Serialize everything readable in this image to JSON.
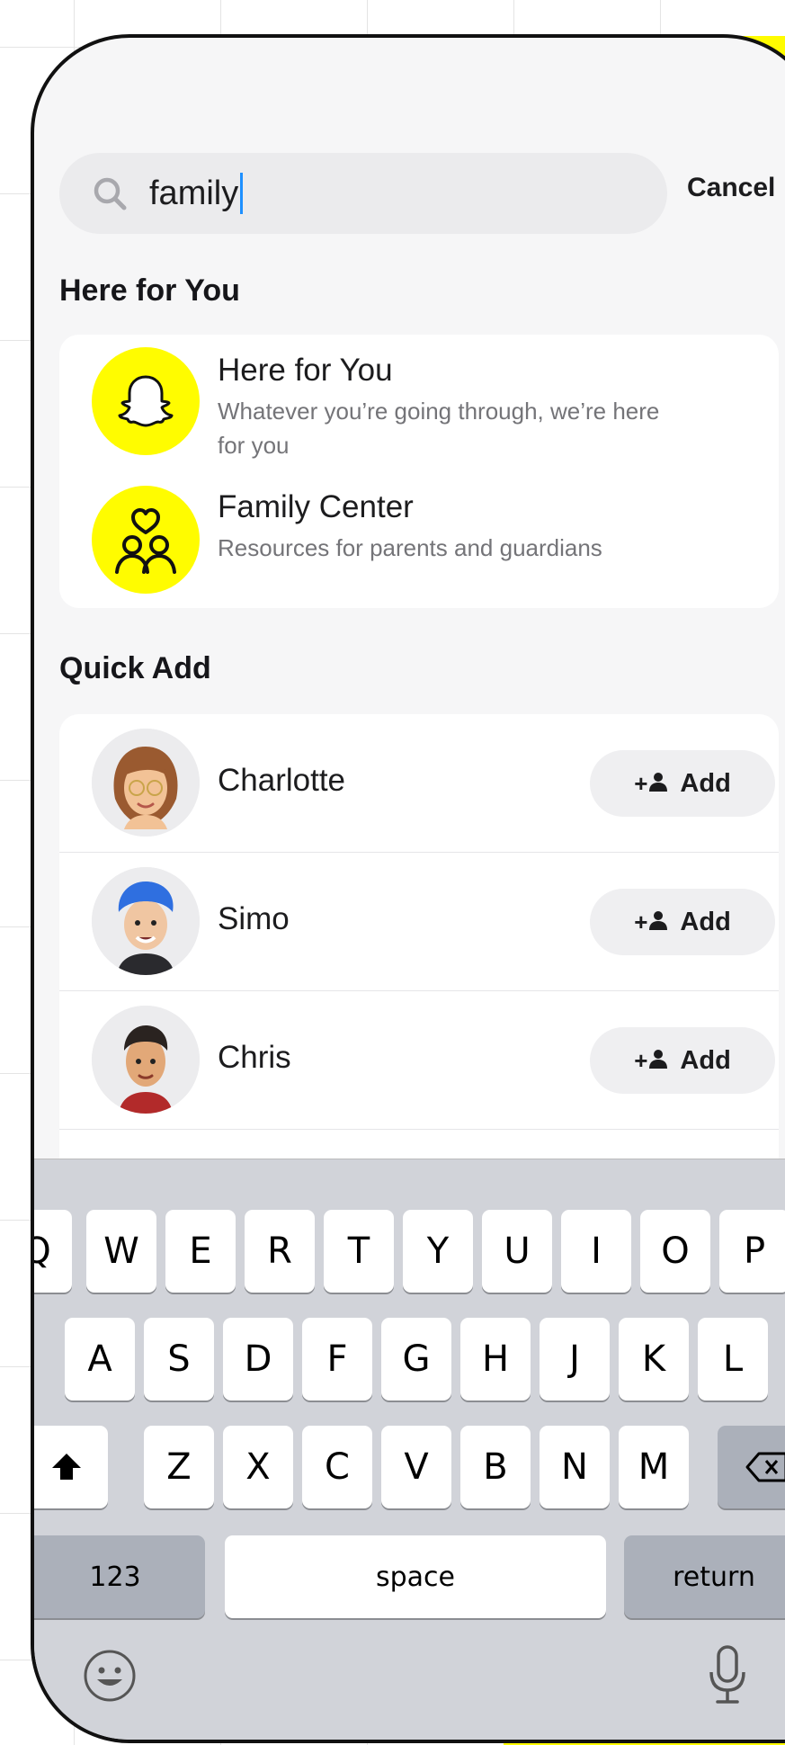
{
  "search": {
    "query": "family",
    "cancel_label": "Cancel"
  },
  "here_for_you": {
    "section_title": "Here for You",
    "items": [
      {
        "title": "Here for You",
        "subtitle_line1": "Whatever you’re going through, we’re here",
        "subtitle_line2": "for you",
        "icon": "ghost-icon"
      },
      {
        "title": "Family Center",
        "subtitle_line1": "Resources for parents and guardians",
        "icon": "family-center-icon"
      }
    ]
  },
  "quick_add": {
    "section_title": "Quick Add",
    "add_label": "Add",
    "add_prefix": "+",
    "people": [
      {
        "name": "Charlotte"
      },
      {
        "name": "Simo"
      },
      {
        "name": "Chris"
      }
    ]
  },
  "keyboard": {
    "row1": [
      "Q",
      "W",
      "E",
      "R",
      "T",
      "Y",
      "U",
      "I",
      "O",
      "P"
    ],
    "row2": [
      "A",
      "S",
      "D",
      "F",
      "G",
      "H",
      "J",
      "K",
      "L"
    ],
    "row3": [
      "Z",
      "X",
      "C",
      "V",
      "B",
      "N",
      "M"
    ],
    "numbers_label": "123",
    "space_label": "space",
    "return_label": "return"
  },
  "colors": {
    "accent_yellow": "#fffc00",
    "caret_blue": "#1e90ff",
    "keyboard_bg": "#d1d3d9"
  }
}
